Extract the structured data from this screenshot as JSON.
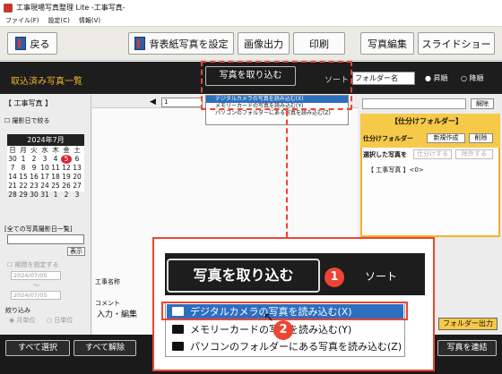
{
  "window": {
    "title": "工事現場写真整理 Lite -工事写真-"
  },
  "menu": [
    "ファイル(F)",
    "設定(C)",
    "情報(V)"
  ],
  "toolbar": {
    "back": "戻る",
    "set_background": "背表紙写真を設定",
    "image_output": "画像出力",
    "print": "印刷",
    "photo_edit": "写真編集",
    "slideshow": "スライドショー"
  },
  "header": {
    "title": "取込済み写真一覧",
    "sort_label": "ソート",
    "folder_select": "フォルダー名",
    "asc": "昇順",
    "desc": "降順"
  },
  "import_menu": {
    "button": "写真を取り込む",
    "items": [
      "デジタルカメラの写真を読み込む(X)",
      "メモリーカードの写真を読み込む(Y)",
      "パソコンのフォルダーにある写真を読み込む(Z)"
    ]
  },
  "left": {
    "folder": "【 工事写真 】",
    "filter_by_date": "撮影日で絞る",
    "calendar": {
      "month": "2024年7月",
      "weekdays": [
        "日",
        "月",
        "火",
        "水",
        "木",
        "金",
        "土"
      ],
      "weeks": [
        [
          "30",
          "1",
          "2",
          "3",
          "4",
          "5",
          "6"
        ],
        [
          "7",
          "8",
          "9",
          "10",
          "11",
          "12",
          "13"
        ],
        [
          "14",
          "15",
          "16",
          "17",
          "18",
          "19",
          "20"
        ],
        [
          "21",
          "22",
          "23",
          "24",
          "25",
          "26",
          "27"
        ],
        [
          "28",
          "29",
          "30",
          "31",
          "1",
          "2",
          "3"
        ]
      ],
      "selected_day": "5"
    },
    "all_dates": "[全ての写真撮影日一覧]",
    "show": "表示",
    "specify_period": "期間を指定する",
    "date_from": "2024/07/05",
    "tilde": "〜",
    "date_to": "2024/07/05",
    "narrow_unit": "絞り込み",
    "unit_month": "月単位",
    "unit_day": "日単位"
  },
  "middle": {
    "page": "1",
    "construction_name": "工事名称",
    "comment": "コメント",
    "input_edit": "入力・編集"
  },
  "right": {
    "clear": "解除",
    "sort_folder_title": "【仕分けフォルダー】",
    "sort_folder_label": "仕分けフォルダー",
    "new_create": "新規作成",
    "delete": "削除",
    "selected_photo": "選択した写真を",
    "sort_in": "仕分けする",
    "exclude": "除外する",
    "tree_item": "【 工事写真 】<0>",
    "folder_output": "フォルダー出力"
  },
  "bottom": {
    "select_all": "すべて選択",
    "deselect_all": "すべて解除",
    "connect": "写真を連結"
  },
  "zoom": {
    "import": "写真を取り込む",
    "sort": "ソート",
    "badge1": "1",
    "badge2": "2",
    "items": [
      "デジタルカメラの写真を読み込む(X)",
      "メモリーカードの写真を読み込む(Y)",
      "パソコンのフォルダーにある写真を読み込む(Z)"
    ]
  }
}
